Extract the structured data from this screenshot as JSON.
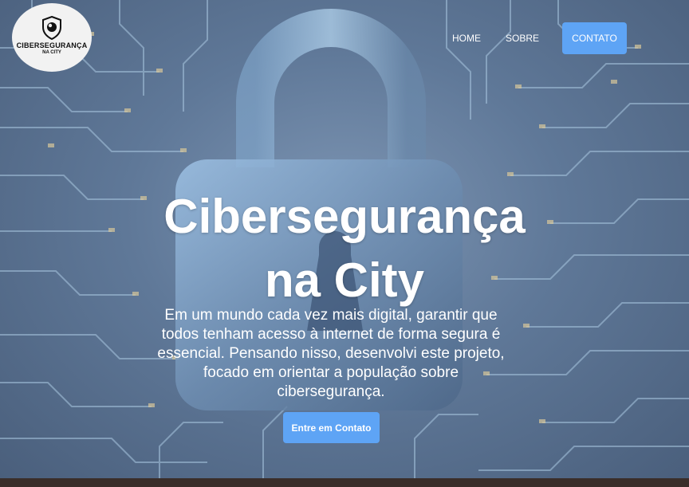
{
  "logo": {
    "title": "CIBERSEGURANÇA",
    "subtitle": "NA CITY",
    "icon": "shield-eye-icon"
  },
  "nav": {
    "home": "HOME",
    "about": "SOBRE",
    "contact": "CONTATO"
  },
  "hero": {
    "title_line1": "Cibersegurança",
    "title_line2": "na City",
    "text": "Em um mundo cada vez mais digital, garantir que todos tenham acesso à internet de forma segura é essencial. Pensando nisso, desenvolvi este projeto, focado em orientar a população sobre cibersegurança.",
    "cta": "Entre em Contato",
    "background": "padlock-circuit-board-image"
  },
  "colors": {
    "accent": "#5ea4f5",
    "background": "#5f7898",
    "text": "#ffffff"
  }
}
